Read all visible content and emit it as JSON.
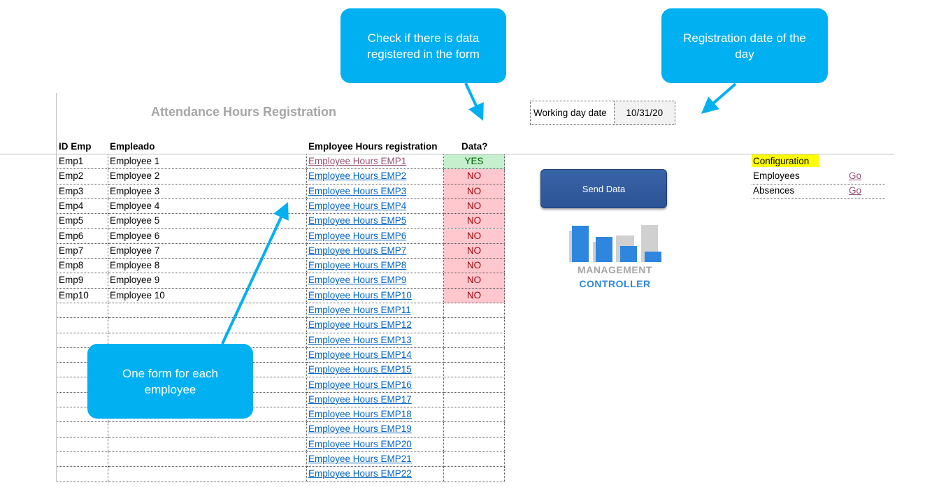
{
  "title": "Attendance Hours Registration",
  "headers": {
    "id": "ID Emp",
    "name": "Empleado",
    "link": "Employee Hours registration",
    "data": "Data?"
  },
  "rows": [
    {
      "id": "Emp1",
      "name": "Employee 1",
      "link": "Employee Hours EMP1",
      "data": "YES"
    },
    {
      "id": "Emp2",
      "name": "Employee 2",
      "link": "Employee Hours EMP2",
      "data": "NO"
    },
    {
      "id": "Emp3",
      "name": "Employee 3",
      "link": "Employee Hours EMP3",
      "data": "NO"
    },
    {
      "id": "Emp4",
      "name": "Employee 4",
      "link": "Employee Hours EMP4",
      "data": "NO"
    },
    {
      "id": "Emp5",
      "name": "Employee 5",
      "link": "Employee Hours EMP5",
      "data": "NO"
    },
    {
      "id": "Emp6",
      "name": "Employee 6",
      "link": "Employee Hours EMP6",
      "data": "NO"
    },
    {
      "id": "Emp7",
      "name": "Employee 7",
      "link": "Employee Hours EMP7",
      "data": "NO"
    },
    {
      "id": "Emp8",
      "name": "Employee 8",
      "link": "Employee Hours EMP8",
      "data": "NO"
    },
    {
      "id": "Emp9",
      "name": "Employee 9",
      "link": "Employee Hours EMP9",
      "data": "NO"
    },
    {
      "id": "Emp10",
      "name": "Employee 10",
      "link": "Employee Hours EMP10",
      "data": "NO"
    },
    {
      "id": "",
      "name": "",
      "link": "Employee Hours EMP11",
      "data": ""
    },
    {
      "id": "",
      "name": "",
      "link": "Employee Hours EMP12",
      "data": ""
    },
    {
      "id": "",
      "name": "",
      "link": "Employee Hours EMP13",
      "data": ""
    },
    {
      "id": "",
      "name": "",
      "link": "Employee Hours EMP14",
      "data": ""
    },
    {
      "id": "",
      "name": "",
      "link": "Employee Hours EMP15",
      "data": ""
    },
    {
      "id": "",
      "name": "",
      "link": "Employee Hours EMP16",
      "data": ""
    },
    {
      "id": "",
      "name": "",
      "link": "Employee Hours EMP17",
      "data": ""
    },
    {
      "id": "",
      "name": "",
      "link": "Employee Hours EMP18",
      "data": ""
    },
    {
      "id": "",
      "name": "",
      "link": "Employee Hours EMP19",
      "data": ""
    },
    {
      "id": "",
      "name": "",
      "link": "Employee Hours EMP20",
      "data": ""
    },
    {
      "id": "",
      "name": "",
      "link": "Employee Hours EMP21",
      "data": ""
    },
    {
      "id": "",
      "name": "",
      "link": "Employee Hours EMP22",
      "data": ""
    }
  ],
  "working_day": {
    "label": "Working day date",
    "value": "10/31/20"
  },
  "send_button": "Send Data",
  "logo": {
    "line1": "MANAGEMENT",
    "line2": "CONTROLLER"
  },
  "configuration": {
    "title": "Configuration",
    "items": [
      {
        "label": "Employees",
        "action": "Go"
      },
      {
        "label": "Absences",
        "action": "Go"
      }
    ]
  },
  "callouts": {
    "check_data": "Check if there is data registered in the form",
    "registration_date": "Registration date of the day",
    "one_form": "One form for each employee"
  },
  "colors": {
    "callout": "#00b0f0",
    "yes_bg": "#c6efce",
    "no_bg": "#ffc7ce",
    "link": "#0563c1",
    "button": "#2b5496",
    "highlight": "#ffff00"
  }
}
